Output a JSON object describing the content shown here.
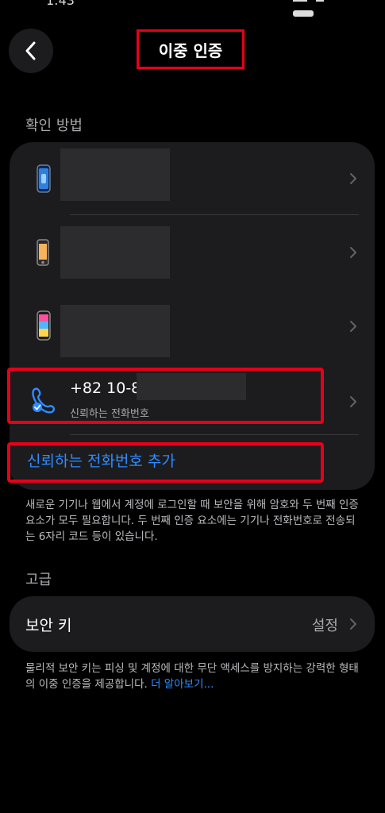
{
  "status_bar": {
    "time": "1:43"
  },
  "header": {
    "title": "이중 인증"
  },
  "verification": {
    "section_title": "확인 방법",
    "devices": [
      {
        "icon": "iphone-blue-icon"
      },
      {
        "icon": "iphone-se-icon"
      },
      {
        "icon": "iphone-color-icon"
      }
    ],
    "phone": {
      "number": "+82 10-8",
      "subtitle": "신뢰하는 전화번호"
    },
    "add_phone_label": "신뢰하는 전화번호 추가",
    "description": "새로운 기기나 웹에서 계정에 로그인할 때 보안을 위해 암호와 두 번째 인증 요소가 모두 필요합니다. 두 번째 인증 요소에는 기기나 전화번호로 전송되는 6자리 코드 등이 있습니다."
  },
  "advanced": {
    "section_title": "고급",
    "security_key": {
      "label": "보안 키",
      "value": "설정"
    },
    "description": "물리적 보안 키는 피싱 및 계정에 대한 무단 액세스를 방지하는 강력한 형태의 이중 인증을 제공합니다.",
    "learn_more": "더 알아보기..."
  },
  "colors": {
    "background": "#000000",
    "card": "#1c1c1e",
    "accent": "#2f8bff",
    "highlight": "#e6001a"
  }
}
